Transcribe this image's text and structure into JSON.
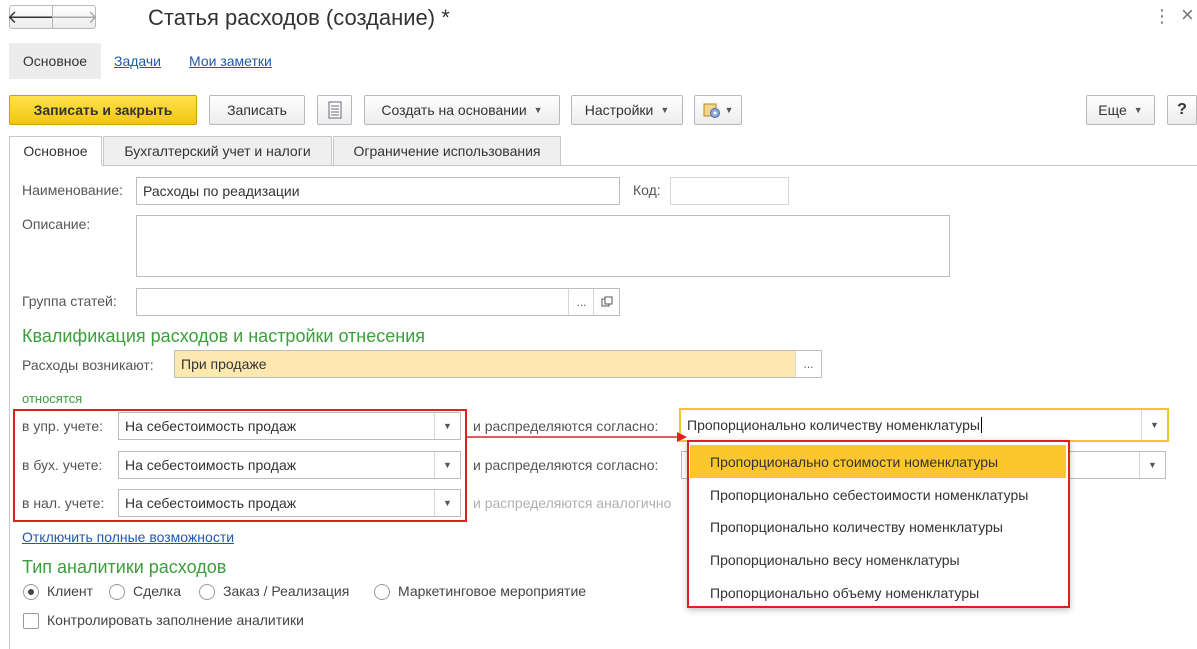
{
  "header": {
    "title": "Статья расходов (создание) *",
    "kebab": "⋮",
    "close": "×"
  },
  "nav_tabs": [
    "Основное",
    "Задачи",
    "Мои заметки"
  ],
  "toolbar": {
    "save_close": "Записать и закрыть",
    "save": "Записать",
    "create_based": "Создать на основании",
    "settings": "Настройки",
    "more": "Еще",
    "help": "?"
  },
  "form_tabs": [
    "Основное",
    "Бухгалтерский учет и налоги",
    "Ограничение использования"
  ],
  "fields": {
    "name_label": "Наименование:",
    "name_value": "Расходы по реадизации",
    "code_label": "Код:",
    "code_value": "",
    "desc_label": "Описание:",
    "desc_value": "",
    "group_label": "Группа статей:",
    "group_value": "",
    "ellipsis": "..."
  },
  "section1": {
    "title": "Квалификация расходов и настройки отнесения",
    "arise_label": "Расходы возникают:",
    "arise_value": "При продаже",
    "relate_label": "относятся",
    "rows": [
      {
        "label": "в упр. учете:",
        "value": "На себестоимость продаж",
        "dist_label": "и распределяются согласно:",
        "dist_value": "Пропорционально количеству номенклатуры"
      },
      {
        "label": "в бух. учете:",
        "value": "На себестоимость продаж",
        "dist_label": "и распределяются согласно:",
        "dist_value": ""
      },
      {
        "label": "в нал. учете:",
        "value": "На себестоимость продаж",
        "dist_label": "и распределяются аналогично",
        "dist_value": ""
      }
    ],
    "disable_link": "Отключить полные возможности"
  },
  "section2": {
    "title": "Тип аналитики расходов",
    "radios": [
      "Клиент",
      "Сделка",
      "Заказ / Реализация",
      "Маркетинговое мероприятие"
    ],
    "selected": "Клиент",
    "checkbox": "Контролировать заполнение аналитики"
  },
  "popup": {
    "items": [
      "Пропорционально стоимости номенклатуры",
      "Пропорционально себестоимости номенклатуры",
      "Пропорционально количеству номенклатуры",
      "Пропорционально весу номенклатуры",
      "Пропорционально объему номенклатуры"
    ],
    "highlighted_index": 0
  },
  "colors": {
    "accent_green": "#3c9e3c",
    "highlight_yellow": "#fbc62e",
    "annotation_red": "#e02020",
    "field_yellow": "#fde8b0"
  }
}
